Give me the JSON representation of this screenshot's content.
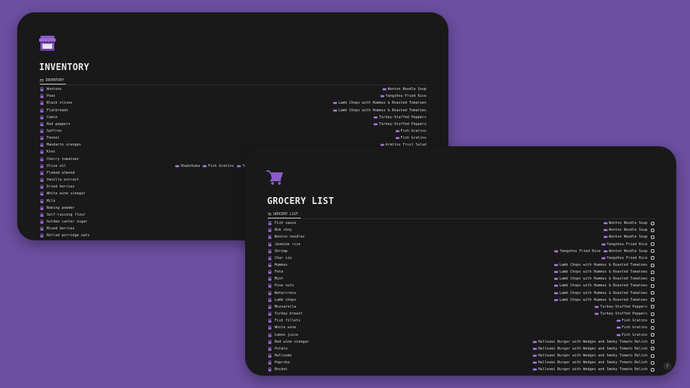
{
  "colors": {
    "background": "#6b4fa0",
    "panel": "#191919",
    "accent": "#8b5cc7",
    "text": "#d8d8d8"
  },
  "inventory": {
    "title": "INVENTORY",
    "view_tab": "INVENTORY",
    "page_icon": "store-icon",
    "rows": [
      {
        "name": "Wontons",
        "tags": [
          "Wonton Noodle Soup"
        ]
      },
      {
        "name": "Peas",
        "tags": [
          "Yangzhou Fried Rice"
        ]
      },
      {
        "name": "Black olives",
        "tags": [
          "Lamb Chops with Hummus & Roasted Tomatoes"
        ]
      },
      {
        "name": "Flatbreads",
        "tags": [
          "Lamb Chops with Hummus & Roasted Tomatoes"
        ]
      },
      {
        "name": "Cumin",
        "tags": [
          "Turkey-Stuffed Peppers"
        ]
      },
      {
        "name": "Red peppers",
        "tags": [
          "Turkey-Stuffed Peppers"
        ]
      },
      {
        "name": "Saffron",
        "tags": [
          "Fish Gratins"
        ]
      },
      {
        "name": "Fennel",
        "tags": [
          "Fish Gratins"
        ]
      },
      {
        "name": "Mandarin oranges",
        "tags": [
          "Armitou Fruit Salad"
        ]
      },
      {
        "name": "Kiwi",
        "tags": []
      },
      {
        "name": "Cherry tomatoes",
        "tags": []
      },
      {
        "name": "Olive oil",
        "tags_mid": [
          "Shakshuka",
          "Fish Gratins",
          "Tu"
        ]
      },
      {
        "name": "Flaked almond",
        "tags": []
      },
      {
        "name": "Vanilla extract",
        "tags": []
      },
      {
        "name": "Dried berries",
        "tags": []
      },
      {
        "name": "White wine vinegar",
        "tags": []
      },
      {
        "name": "Milk",
        "tags": []
      },
      {
        "name": "Baking powder",
        "tags": []
      },
      {
        "name": "Self-raising flour",
        "tags": []
      },
      {
        "name": "Golden caster sugar",
        "tags": []
      },
      {
        "name": "Mixed berries",
        "tags": []
      },
      {
        "name": "Rolled porridge oats",
        "tags": []
      }
    ]
  },
  "grocery": {
    "title": "GROCERY LIST",
    "view_tab": "GROCERY LIST",
    "page_icon": "shopping-cart-icon",
    "rows": [
      {
        "name": "Fish sauce",
        "tags": [
          "Wonton Noodle Soup"
        ]
      },
      {
        "name": "Bok choy",
        "tags": [
          "Wonton Noodle Soup"
        ]
      },
      {
        "name": "Wonton noodles",
        "tags": [
          "Wonton Noodle Soup"
        ]
      },
      {
        "name": "Jasmine rice",
        "tags": [
          "Yangzhou Fried Rice"
        ]
      },
      {
        "name": "Shrimp",
        "tags": [
          "Yangzhou Fried Rice",
          "Wonton Noodle Soup"
        ]
      },
      {
        "name": "Char siu",
        "tags": [
          "Yangzhou Fried Rice"
        ]
      },
      {
        "name": "Hummus",
        "tags": [
          "Lamb Chops with Hummus & Roasted Tomatoes"
        ]
      },
      {
        "name": "Feta",
        "tags": [
          "Lamb Chops with Hummus & Roasted Tomatoes"
        ]
      },
      {
        "name": "Mint",
        "tags": [
          "Lamb Chops with Hummus & Roasted Tomatoes"
        ]
      },
      {
        "name": "Pine nuts",
        "tags": [
          "Lamb Chops with Hummus & Roasted Tomatoes"
        ]
      },
      {
        "name": "Watercress",
        "tags": [
          "Lamb Chops with Hummus & Roasted Tomatoes"
        ]
      },
      {
        "name": "Lamb chops",
        "tags": [
          "Lamb Chops with Hummus & Roasted Tomatoes"
        ]
      },
      {
        "name": "Mozzarella",
        "tags": [
          "Turkey-Stuffed Peppers"
        ]
      },
      {
        "name": "Turkey breast",
        "tags": [
          "Turkey-Stuffed Peppers"
        ]
      },
      {
        "name": "Fish fillets",
        "tags": [
          "Fish Gratins"
        ]
      },
      {
        "name": "White wine",
        "tags": [
          "Fish Gratins"
        ]
      },
      {
        "name": "Lemon juice",
        "tags": [
          "Fish Gratins"
        ]
      },
      {
        "name": "Red wine vinegar",
        "tags": [
          "Halloumi Burger with Wedges and Smoky Tomato Relish"
        ]
      },
      {
        "name": "Potato",
        "tags": [
          "Halloumi Burger with Wedges and Smoky Tomato Relish"
        ]
      },
      {
        "name": "Halloumi",
        "tags": [
          "Halloumi Burger with Wedges and Smoky Tomato Relish"
        ]
      },
      {
        "name": "Paprika",
        "tags": [
          "Halloumi Burger with Wedges and Smoky Tomato Relish"
        ]
      },
      {
        "name": "Rocket",
        "tags": [
          "Halloumi Burger with Wedges and Smoky Tomato Relish"
        ]
      }
    ]
  },
  "help": {
    "label": "?"
  }
}
